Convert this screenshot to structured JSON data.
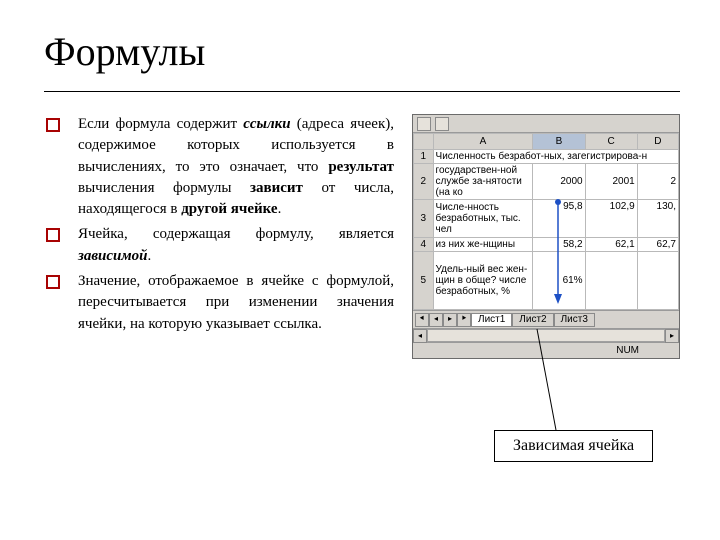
{
  "title": "Формулы",
  "bullets": [
    {
      "pre": "Если формула содержит ",
      "b1": "ссылки",
      "mid1": " (адреса ячеек), содержимое которых используется в вычислениях, то это означает, что ",
      "b2": "результат",
      "mid2": " вычисления формулы ",
      "b3": "зависит",
      "mid3": " от числа, находящегося в ",
      "b4": "другой ячейке",
      "end": "."
    },
    {
      "pre": "Ячейка, содержащая формулу, является ",
      "b1": "зависимой",
      "end": "."
    },
    {
      "pre": "Значение, отображаемое в ячейке с формулой, пересчитывается при изменении значения ячейки, на которую указывает ссылка."
    }
  ],
  "sheet": {
    "cols": [
      "A",
      "B",
      "C",
      "D"
    ],
    "selectedCol": "B",
    "rows": [
      {
        "n": "1",
        "A": "Численность безработ-ных, загегистрирова-н",
        "B": "",
        "C": "",
        "D": ""
      },
      {
        "n": "2",
        "A": "государствен-ной службе за-нятости (на ко",
        "B": "2000",
        "C": "2001",
        "D": "2"
      },
      {
        "n": "3",
        "A": "Числе-нность безработных, тыс. чел",
        "B": "95,8",
        "C": "102,9",
        "D": "130,"
      },
      {
        "n": "4",
        "A": "из них же-нщины",
        "B": "58,2",
        "C": "62,1",
        "D": "62,7"
      },
      {
        "n": "5",
        "A": "Удель-ный вес жен-щин в обще? числе безработных, %",
        "B": "61%",
        "C": "",
        "D": ""
      }
    ],
    "tabs": [
      "Лист1",
      "Лист2",
      "Лист3"
    ],
    "status": "NUM"
  },
  "callout": "Зависимая ячейка"
}
